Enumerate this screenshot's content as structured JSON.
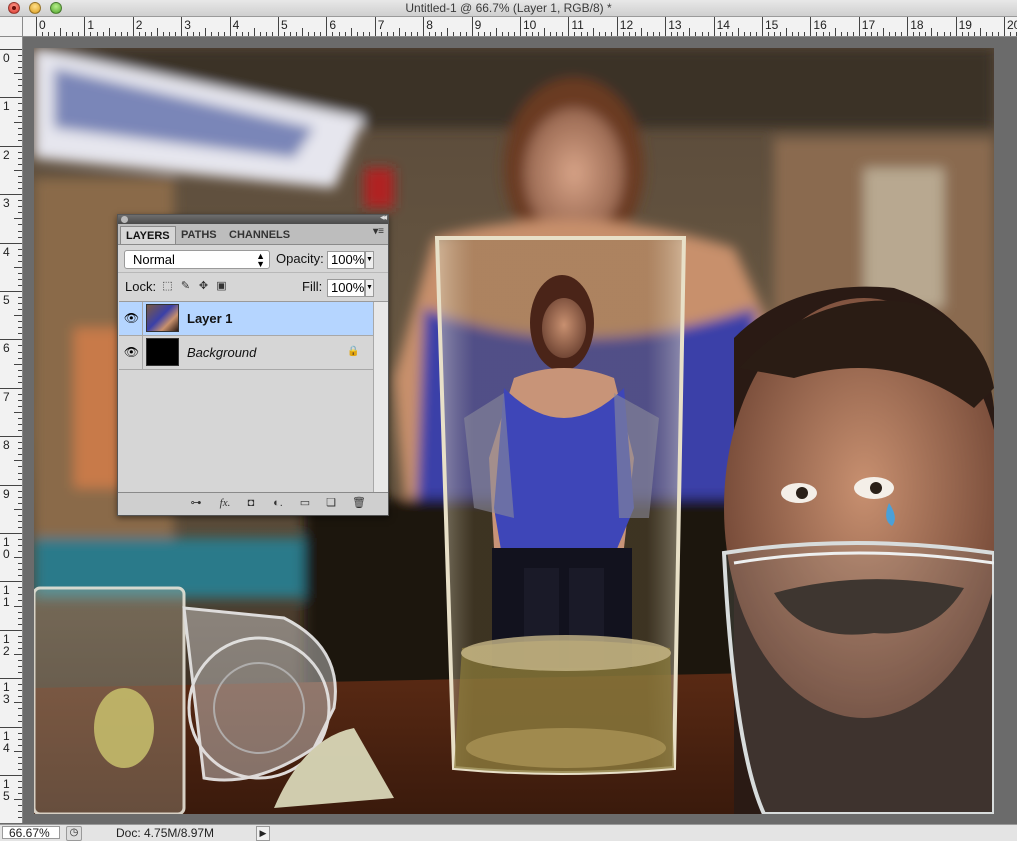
{
  "window": {
    "title": "Untitled-1 @ 66.7% (Layer 1, RGB/8) *"
  },
  "rulers": {
    "top_labels": [
      "0",
      "1",
      "2",
      "3",
      "4",
      "5",
      "6",
      "7",
      "8",
      "9",
      "10",
      "11",
      "12",
      "13",
      "14",
      "15",
      "16",
      "17",
      "18",
      "19",
      "20"
    ],
    "left_labels": [
      "0",
      "1",
      "2",
      "3",
      "4",
      "5",
      "6",
      "7",
      "8",
      "9",
      "10",
      "11",
      "12",
      "13",
      "14",
      "15"
    ]
  },
  "layers_panel": {
    "tabs": [
      "LAYERS",
      "PATHS",
      "CHANNELS"
    ],
    "blend_mode": "Normal",
    "opacity_label": "Opacity:",
    "opacity_value": "100%",
    "lock_label": "Lock:",
    "fill_label": "Fill:",
    "fill_value": "100%",
    "layers": [
      {
        "name": "Layer 1",
        "selected": true,
        "visible": true
      },
      {
        "name": "Background",
        "selected": false,
        "visible": true,
        "locked": true
      }
    ],
    "bottom_icons": [
      "link-layers-icon",
      "fx-icon",
      "add-mask-icon",
      "adjustment-layer-icon",
      "new-group-icon",
      "new-layer-icon",
      "delete-layer-icon"
    ]
  },
  "status_bar": {
    "zoom": "66.67%",
    "doc_info": "Doc: 4.75M/8.97M"
  }
}
